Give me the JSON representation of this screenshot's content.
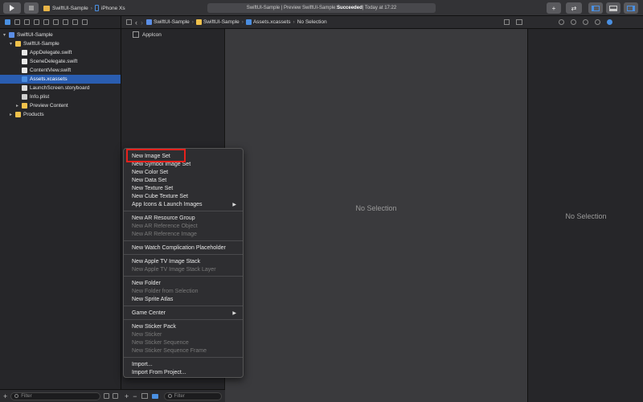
{
  "toolbar": {
    "scheme_project": "SwiftUI-Sample",
    "scheme_device": "iPhone Xs",
    "activity_prefix": "SwiftUI-Sample | Preview SwiftUI-Sample: ",
    "activity_status": "Succeeded",
    "activity_time": " | Today at 17:22",
    "add_label": "+",
    "swap_label": "⇄"
  },
  "navigator": {
    "tree": [
      {
        "label": "SwiftUI-Sample",
        "kind": "project",
        "level": 0,
        "expanded": true
      },
      {
        "label": "SwiftUI-Sample",
        "kind": "folder",
        "level": 1,
        "expanded": true
      },
      {
        "label": "AppDelegate.swift",
        "kind": "swift",
        "level": 2
      },
      {
        "label": "SceneDelegate.swift",
        "kind": "swift",
        "level": 2
      },
      {
        "label": "ContentView.swift",
        "kind": "swift",
        "level": 2
      },
      {
        "label": "Assets.xcassets",
        "kind": "assets",
        "level": 2,
        "selected": true
      },
      {
        "label": "LaunchScreen.storyboard",
        "kind": "storyboard",
        "level": 2
      },
      {
        "label": "Info.plist",
        "kind": "plist",
        "level": 2
      },
      {
        "label": "Preview Content",
        "kind": "folder",
        "level": 2,
        "collapsed": true
      },
      {
        "label": "Products",
        "kind": "folder",
        "level": 1,
        "collapsed": true
      }
    ],
    "filter_placeholder": "Filter"
  },
  "jumpbar": {
    "crumbs": [
      "SwiftUI-Sample",
      "SwiftUI-Sample",
      "Assets.xcassets",
      "No Selection"
    ]
  },
  "asset_list": {
    "items": [
      "AppIcon"
    ],
    "filter_placeholder": "Filter",
    "add_label": "+",
    "remove_label": "−"
  },
  "editor": {
    "empty_text": "No Selection"
  },
  "inspector": {
    "empty_text": "No Selection"
  },
  "context_menu": {
    "groups": [
      [
        {
          "label": "New Image Set",
          "enabled": true,
          "highlighted": true
        },
        {
          "label": "New Symbol Image Set",
          "enabled": true
        },
        {
          "label": "New Color Set",
          "enabled": true
        },
        {
          "label": "New Data Set",
          "enabled": true
        },
        {
          "label": "New Texture Set",
          "enabled": true
        },
        {
          "label": "New Cube Texture Set",
          "enabled": true
        },
        {
          "label": "App Icons & Launch Images",
          "enabled": true,
          "submenu": true
        }
      ],
      [
        {
          "label": "New AR Resource Group",
          "enabled": true
        },
        {
          "label": "New AR Reference Object",
          "enabled": false
        },
        {
          "label": "New AR Reference Image",
          "enabled": false
        }
      ],
      [
        {
          "label": "New Watch Complication Placeholder",
          "enabled": true
        }
      ],
      [
        {
          "label": "New Apple TV Image Stack",
          "enabled": true
        },
        {
          "label": "New Apple TV Image Stack Layer",
          "enabled": false
        }
      ],
      [
        {
          "label": "New Folder",
          "enabled": true
        },
        {
          "label": "New Folder from Selection",
          "enabled": false
        },
        {
          "label": "New Sprite Atlas",
          "enabled": true
        }
      ],
      [
        {
          "label": "Game Center",
          "enabled": true,
          "submenu": true
        }
      ],
      [
        {
          "label": "New Sticker Pack",
          "enabled": true
        },
        {
          "label": "New Sticker",
          "enabled": false
        },
        {
          "label": "New Sticker Sequence",
          "enabled": false
        },
        {
          "label": "New Sticker Sequence Frame",
          "enabled": false
        }
      ],
      [
        {
          "label": "Import...",
          "enabled": true
        },
        {
          "label": "Import From Project...",
          "enabled": true
        }
      ]
    ]
  },
  "colors": {
    "selection": "#2a5db0",
    "highlight_outline": "#e8211c",
    "accent": "#4a90e2"
  }
}
